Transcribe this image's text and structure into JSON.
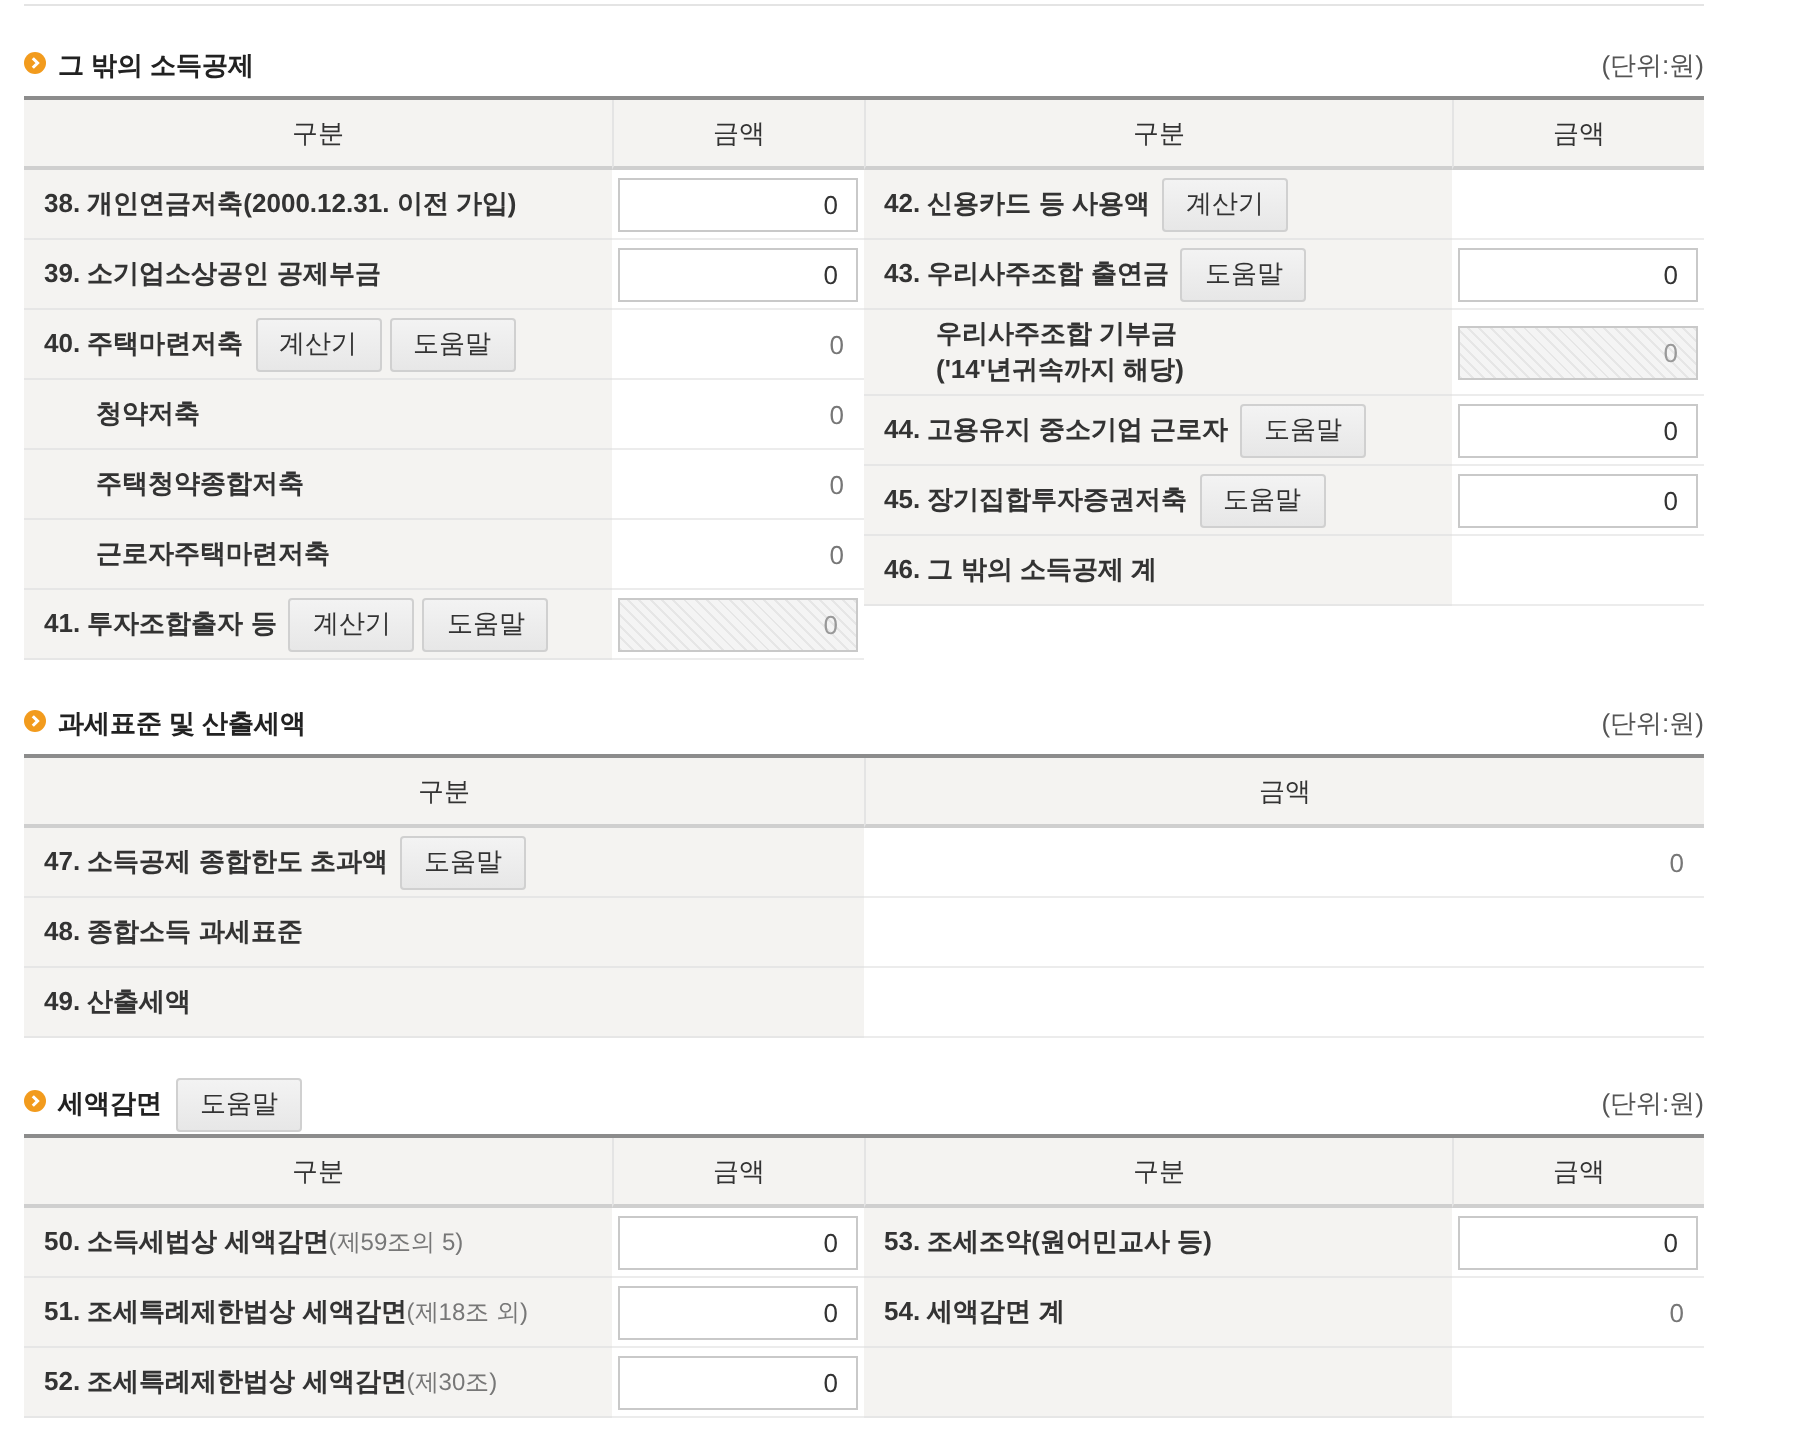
{
  "sections": [
    {
      "kind": "split",
      "title": "그 밖의 소득공제",
      "unit": "(단위:원)",
      "groups": [
        {
          "columns": [
            "구분",
            "금액"
          ],
          "rows": [
            {
              "label": "38. 개인연금저축(2000.12.31. 이전 가입)",
              "amount": {
                "kind": "field",
                "value": "0",
                "disabled": false
              }
            },
            {
              "label": "39. 소기업소상공인 공제부금",
              "amount": {
                "kind": "field",
                "value": "0",
                "disabled": false
              }
            },
            {
              "label": "40. 주택마련저축",
              "calculator_button": "계산기",
              "help_button": "도움말",
              "amount": {
                "kind": "text",
                "value": "0"
              },
              "children": [
                {
                  "label": "청약저축",
                  "amount": {
                    "kind": "text",
                    "value": "0"
                  }
                },
                {
                  "label": "주택청약종합저축",
                  "amount": {
                    "kind": "text",
                    "value": "0"
                  }
                },
                {
                  "label": "근로자주택마련저축",
                  "amount": {
                    "kind": "text",
                    "value": "0"
                  }
                }
              ]
            },
            {
              "label": "41. 투자조합출자 등",
              "calculator_button": "계산기",
              "help_button": "도움말",
              "amount": {
                "kind": "field",
                "value": "0",
                "disabled": true
              }
            }
          ]
        },
        {
          "columns": [
            "구분",
            "금액"
          ],
          "rows": [
            {
              "label": "42. 신용카드 등 사용액",
              "calculator_button": "계산기"
            },
            {
              "label": "43. 우리사주조합 출연금",
              "help_button": "도움말",
              "amount": {
                "kind": "field",
                "value": "0",
                "disabled": false
              },
              "children": [
                {
                  "label": "우리사주조합 기부금\n('14'년귀속까지 해당)",
                  "amount": {
                    "kind": "field",
                    "value": "0",
                    "disabled": true
                  }
                }
              ]
            },
            {
              "label": "44. 고용유지 중소기업 근로자",
              "help_button": "도움말",
              "amount": {
                "kind": "field",
                "value": "0",
                "disabled": false
              }
            },
            {
              "label": "45. 장기집합투자증권저축",
              "help_button": "도움말",
              "amount": {
                "kind": "field",
                "value": "0",
                "disabled": false
              }
            },
            {
              "label": "46. 그 밖의 소득공제 계"
            }
          ]
        }
      ]
    },
    {
      "kind": "table",
      "title": "과세표준 및 산출세액",
      "unit": "(단위:원)",
      "groups": [
        {
          "columns": [
            "구분",
            "금액"
          ],
          "rows": [
            {
              "label": "47. 소득공제 종합한도 초과액",
              "help_button": "도움말",
              "amount": {
                "kind": "text",
                "value": "0"
              }
            },
            {
              "label": "48. 종합소득 과세표준"
            },
            {
              "label": "49. 산출세액"
            }
          ]
        }
      ]
    },
    {
      "kind": "table",
      "title": "세액감면",
      "help_button": "도움말",
      "unit": "(단위:원)",
      "groups": [
        {
          "columns": [
            "구분",
            "금액"
          ],
          "rows": [
            {
              "label": "50. 소득세법상 세액감면",
              "note": "(제59조의 5)",
              "amount": {
                "kind": "field",
                "value": "0",
                "disabled": false
              }
            },
            {
              "label": "51. 조세특례제한법상 세액감면",
              "note": "(제18조 외)",
              "amount": {
                "kind": "field",
                "value": "0",
                "disabled": false
              }
            },
            {
              "label": "52. 조세특례제한법상 세액감면",
              "note": "(제30조)",
              "amount": {
                "kind": "field",
                "value": "0",
                "disabled": false
              }
            }
          ]
        },
        {
          "columns": [
            "구분",
            "금액"
          ],
          "rows": [
            {
              "label": "53. 조세조약(원어민교사 등)",
              "amount": {
                "kind": "field",
                "value": "0",
                "disabled": false
              }
            },
            {
              "label": "54. 세액감면 계",
              "amount": {
                "kind": "text",
                "value": "0"
              }
            }
          ]
        }
      ]
    }
  ]
}
